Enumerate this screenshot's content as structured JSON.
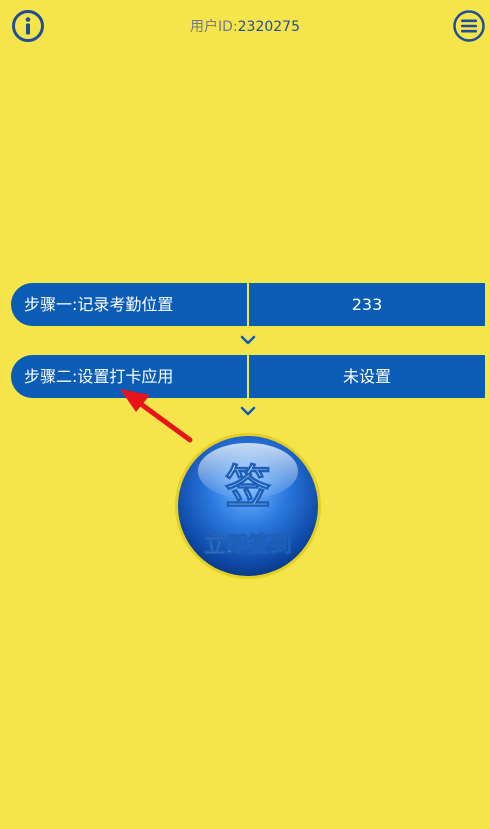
{
  "header": {
    "user_id_label": "用户ID:",
    "user_id_value": "2320275",
    "info_icon": "info-icon",
    "menu_icon": "menu-icon"
  },
  "steps": [
    {
      "label": "步骤一:记录考勤位置",
      "value": "233"
    },
    {
      "label": "步骤二:设置打卡应用",
      "value": "未设置"
    }
  ],
  "sign_button": {
    "big_char": "签",
    "caption": "立即签到"
  },
  "colors": {
    "background": "#f6e54a",
    "row_blue": "#0b5cb4",
    "accent_blue": "#1f4e99",
    "annotation_red": "#e8141c"
  }
}
